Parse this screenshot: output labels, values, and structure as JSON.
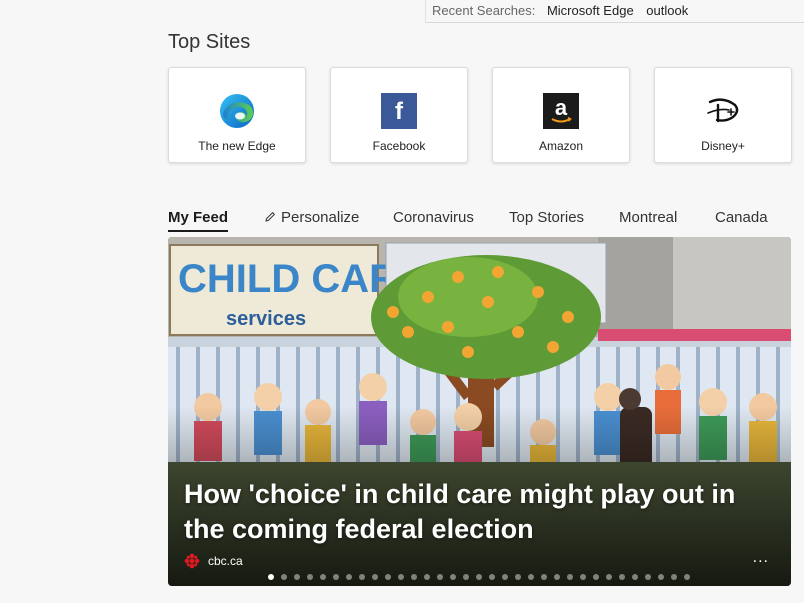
{
  "recent_searches": {
    "label": "Recent Searches:",
    "terms": [
      "Microsoft Edge",
      "outlook"
    ]
  },
  "top_sites": {
    "title": "Top Sites",
    "sites": [
      {
        "name": "The new Edge",
        "icon": "edge-icon"
      },
      {
        "name": "Facebook",
        "icon": "facebook-icon",
        "glyph": "f"
      },
      {
        "name": "Amazon",
        "icon": "amazon-icon",
        "glyph": "a"
      },
      {
        "name": "Disney+",
        "icon": "disney-icon"
      }
    ]
  },
  "feed_tabs": [
    {
      "label": "My Feed",
      "active": true
    },
    {
      "label": "Personalize",
      "icon": "pencil-icon"
    },
    {
      "label": "Coronavirus"
    },
    {
      "label": "Top Stories"
    },
    {
      "label": "Montreal"
    },
    {
      "label": "Canada"
    }
  ],
  "hero_article": {
    "headline": "How 'choice' in child care might play out in the coming federal election",
    "source": "cbc.ca",
    "source_icon": "cbc-logo-icon",
    "more_label": "...",
    "slide_count": 33,
    "active_slide": 1,
    "sign_text": "CHILD CARE",
    "sign_subtext": "services"
  },
  "colors": {
    "facebook": "#3b5998",
    "amazon_bg": "#1b1b1b",
    "cbc_red": "#e11a22",
    "edge_blue": "#0c7bd6",
    "edge_green": "#4fc14a"
  }
}
